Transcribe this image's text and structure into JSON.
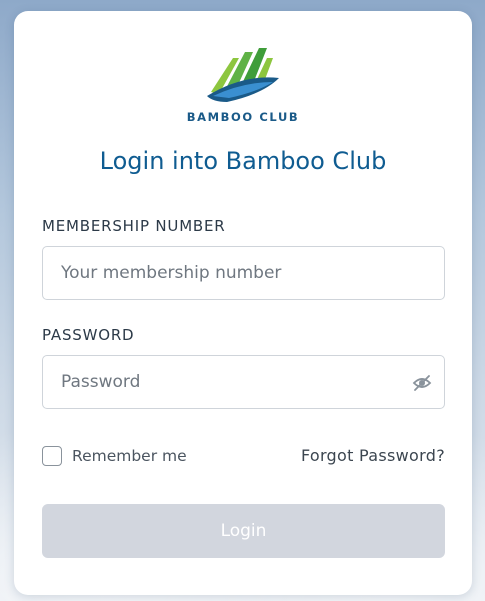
{
  "logo": {
    "text": "BAMBOO CLUB",
    "colors": {
      "green": "#5fb246",
      "blue": "#1a5a88"
    }
  },
  "title": "Login into Bamboo Club",
  "membership": {
    "label": "MEMBERSHIP NUMBER",
    "placeholder": "Your membership number",
    "value": ""
  },
  "password": {
    "label": "PASSWORD",
    "placeholder": "Password",
    "value": "",
    "toggle_icon": "eye-slash-icon"
  },
  "remember": {
    "label": "Remember me",
    "checked": false
  },
  "forgot_label": "Forgot Password?",
  "login_label": "Login",
  "colors": {
    "title": "#0f5c91",
    "button_disabled": "#d2d6de"
  }
}
